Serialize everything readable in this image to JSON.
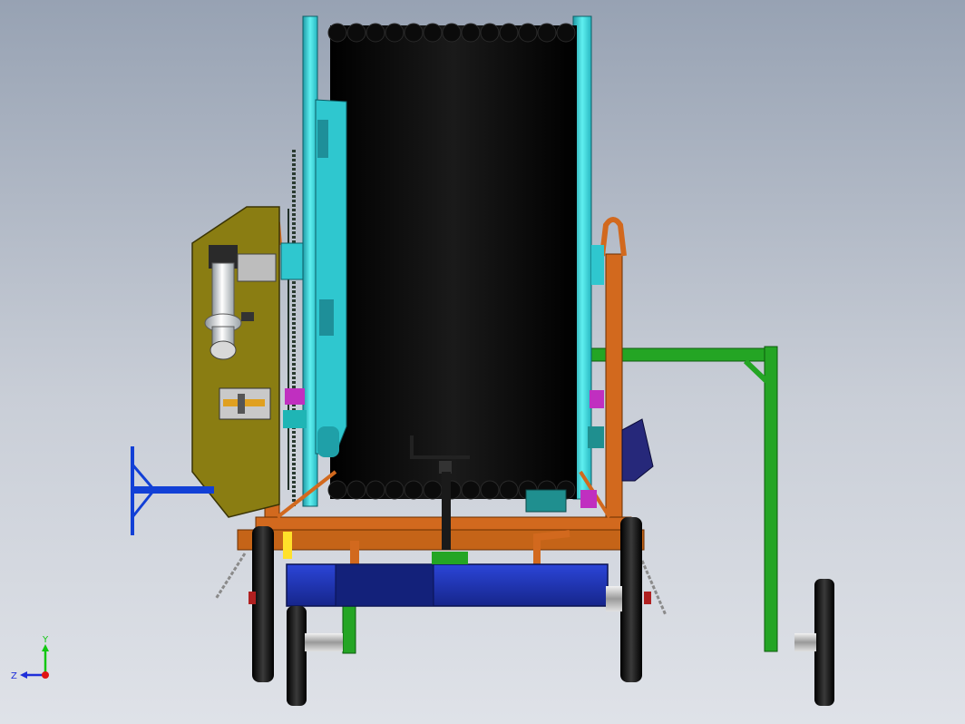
{
  "triad": {
    "y_label": "Y",
    "z_label": "Z",
    "y_color": "#12c712",
    "z_color": "#1f2fd9",
    "x_color": "#e01414"
  },
  "colors": {
    "frame_orange": "#d2691e",
    "reel_cyan": "#3fd9d9",
    "hose_black": "#050505",
    "panel_olive": "#8a7d12",
    "chassis_blue": "#1b2fa8",
    "green_frame": "#24a524",
    "wheel_dark": "#1a1a1a",
    "pipe_white": "#e9edf0",
    "crank_blue": "#1240d6"
  }
}
